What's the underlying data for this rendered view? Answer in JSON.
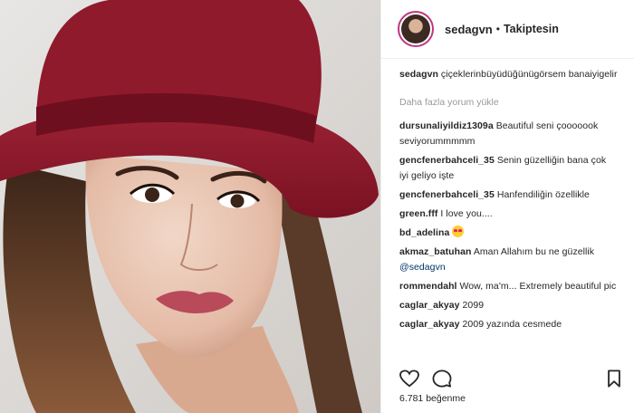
{
  "header": {
    "username": "sedagvn",
    "separator": "•",
    "follow_state": "Takiptesin"
  },
  "caption": {
    "username": "sedagvn",
    "text": "çiçeklerinbüyüdüğünügörsem banaiyigelir"
  },
  "load_more": "Daha fazla yorum yükle",
  "comments": [
    {
      "username": "dursunaliyildiz1309a",
      "text": "Beautiful seni çooooook seviyorummmmm"
    },
    {
      "username": "gencfenerbahceli_35",
      "text": "Senin güzelliğin bana çok iyi geliyo işte"
    },
    {
      "username": "gencfenerbahceli_35",
      "text": "Hanfendiliğin özellikle"
    },
    {
      "username": "green.fff",
      "text": "I love you...."
    },
    {
      "username": "bd_adelina",
      "text": ""
    },
    {
      "username": "akmaz_batuhan",
      "text": "Aman Allahım bu ne güzellik",
      "mention": "@sedagvn"
    },
    {
      "username": "rommendahl",
      "text": "Wow, ma'm... Extremely beautiful pic"
    },
    {
      "username": "caglar_akyay",
      "text": "2099"
    },
    {
      "username": "caglar_akyay",
      "text": "2009 yazında cesmede"
    }
  ],
  "likes": "6.781 beğenme",
  "icons": {
    "like": "heart-icon",
    "comment": "comment-icon",
    "save": "bookmark-icon",
    "emoji": "heart-eyes-emoji"
  },
  "colors": {
    "hat": "#8f1a2c",
    "text": "#262626",
    "muted": "#999999",
    "mention": "#003569"
  }
}
